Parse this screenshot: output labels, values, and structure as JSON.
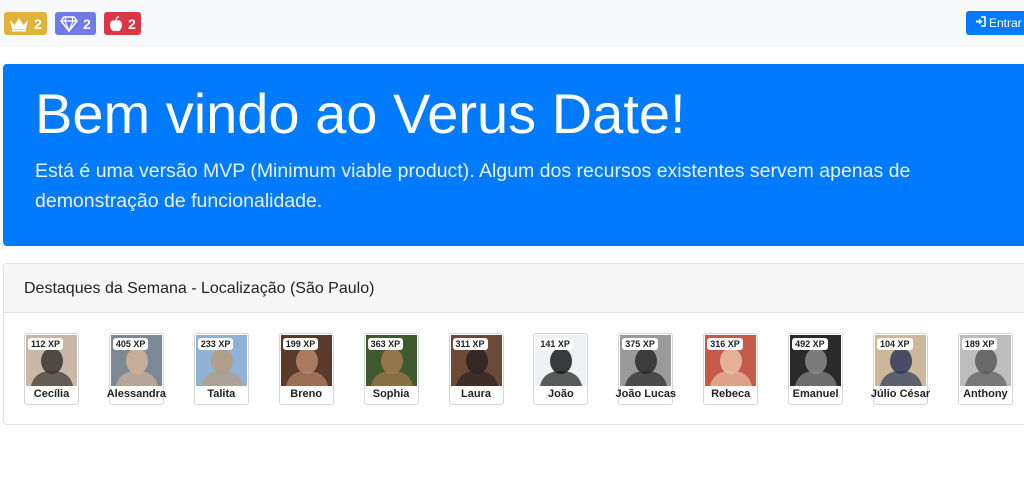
{
  "topbar": {
    "badges": [
      {
        "icon": "crown-icon",
        "count": "2",
        "color": "#e0b33a"
      },
      {
        "icon": "gem-icon",
        "count": "2",
        "color": "#6f7ce8"
      },
      {
        "icon": "apple-icon",
        "count": "2",
        "color": "#dc3545"
      }
    ],
    "login_label": "Entrar",
    "login_icon": "sign-in-icon"
  },
  "hero": {
    "title": "Bem vindo ao Verus Date!",
    "text": "Está é uma versão MVP (Minimum viable product). Algum dos recursos existentes servem apenas de demonstração de funcionalidade."
  },
  "highlights": {
    "title": "Destaques da Semana - Localização (São Paulo)",
    "users": [
      {
        "name": "Cecília",
        "xp": "112 XP"
      },
      {
        "name": "Alessandra",
        "xp": "405 XP"
      },
      {
        "name": "Talita",
        "xp": "233 XP"
      },
      {
        "name": "Breno",
        "xp": "199 XP"
      },
      {
        "name": "Sophia",
        "xp": "363 XP"
      },
      {
        "name": "Laura",
        "xp": "311 XP"
      },
      {
        "name": "João",
        "xp": "141 XP"
      },
      {
        "name": "João Lucas",
        "xp": "375 XP"
      },
      {
        "name": "Rebeca",
        "xp": "316 XP"
      },
      {
        "name": "Emanuel",
        "xp": "492 XP"
      },
      {
        "name": "Júlio César",
        "xp": "104 XP"
      },
      {
        "name": "Anthony",
        "xp": "189 XP"
      }
    ]
  },
  "colors": {
    "primary": "#007bff",
    "crown": "#e0b33a",
    "gem": "#6f7ce8",
    "apple": "#dc3545"
  }
}
